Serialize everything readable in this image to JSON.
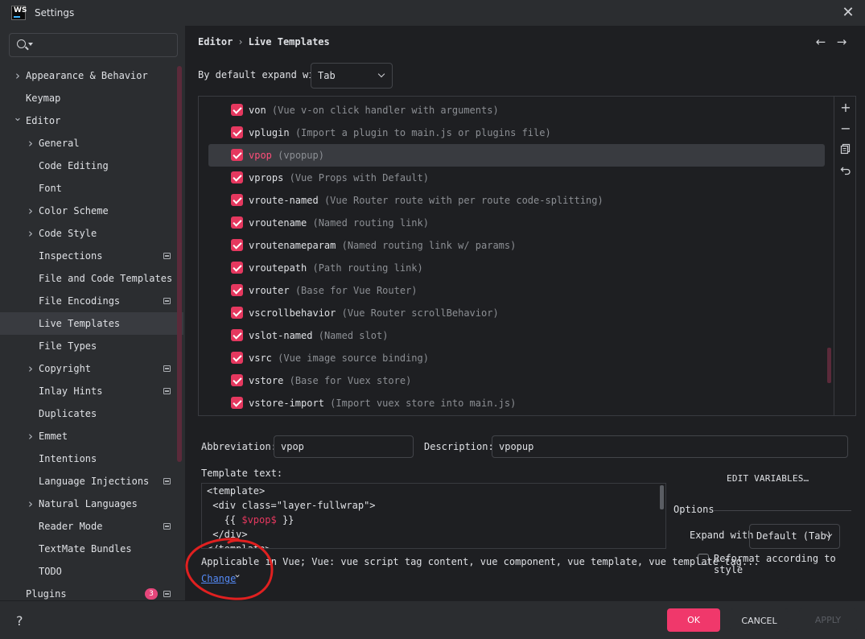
{
  "window": {
    "logo_text": "WS",
    "title": "Settings",
    "close_icon": "close-icon"
  },
  "sidebar": {
    "search": {
      "value": "",
      "placeholder": ""
    },
    "items": [
      {
        "label": "Appearance & Behavior",
        "level": 0,
        "expandable": true,
        "expanded": false
      },
      {
        "label": "Keymap",
        "level": 0,
        "expandable": false
      },
      {
        "label": "Editor",
        "level": 0,
        "expandable": true,
        "expanded": true
      },
      {
        "label": "General",
        "level": 1,
        "expandable": true,
        "expanded": false
      },
      {
        "label": "Code Editing",
        "level": 1,
        "expandable": false
      },
      {
        "label": "Font",
        "level": 1,
        "expandable": false
      },
      {
        "label": "Color Scheme",
        "level": 1,
        "expandable": true,
        "expanded": false
      },
      {
        "label": "Code Style",
        "level": 1,
        "expandable": true,
        "expanded": false
      },
      {
        "label": "Inspections",
        "level": 1,
        "expandable": false,
        "project_icon": true
      },
      {
        "label": "File and Code Templates",
        "level": 1,
        "expandable": false
      },
      {
        "label": "File Encodings",
        "level": 1,
        "expandable": false,
        "project_icon": true
      },
      {
        "label": "Live Templates",
        "level": 1,
        "expandable": false,
        "selected": true
      },
      {
        "label": "File Types",
        "level": 1,
        "expandable": false
      },
      {
        "label": "Copyright",
        "level": 1,
        "expandable": true,
        "expanded": false,
        "project_icon": true
      },
      {
        "label": "Inlay Hints",
        "level": 1,
        "expandable": false,
        "project_icon": true
      },
      {
        "label": "Duplicates",
        "level": 1,
        "expandable": false
      },
      {
        "label": "Emmet",
        "level": 1,
        "expandable": true,
        "expanded": false
      },
      {
        "label": "Intentions",
        "level": 1,
        "expandable": false
      },
      {
        "label": "Language Injections",
        "level": 1,
        "expandable": false,
        "project_icon": true
      },
      {
        "label": "Natural Languages",
        "level": 1,
        "expandable": true,
        "expanded": false
      },
      {
        "label": "Reader Mode",
        "level": 1,
        "expandable": false,
        "project_icon": true
      },
      {
        "label": "TextMate Bundles",
        "level": 1,
        "expandable": false
      },
      {
        "label": "TODO",
        "level": 1,
        "expandable": false
      },
      {
        "label": "Plugins",
        "level": 0,
        "expandable": false,
        "badge": "3",
        "project_icon": true
      }
    ]
  },
  "main": {
    "breadcrumb": {
      "parent": "Editor",
      "separator": "›",
      "current": "Live Templates"
    },
    "expand": {
      "label": "By default expand with",
      "value": "Tab"
    },
    "templates": [
      {
        "abbr": "von",
        "desc": "(Vue v-on click handler with arguments)",
        "checked": true
      },
      {
        "abbr": "vplugin",
        "desc": "(Import a plugin to main.js or plugins file)",
        "checked": true
      },
      {
        "abbr": "vpop",
        "desc": "(vpopup)",
        "checked": true,
        "selected": true
      },
      {
        "abbr": "vprops",
        "desc": "(Vue Props with Default)",
        "checked": true
      },
      {
        "abbr": "vroute-named",
        "desc": "(Vue Router route with per route code-splitting)",
        "checked": true
      },
      {
        "abbr": "vroutename",
        "desc": "(Named routing link)",
        "checked": true
      },
      {
        "abbr": "vroutenameparam",
        "desc": "(Named routing link w/ params)",
        "checked": true
      },
      {
        "abbr": "vroutepath",
        "desc": "(Path routing link)",
        "checked": true
      },
      {
        "abbr": "vrouter",
        "desc": "(Base for Vue Router)",
        "checked": true
      },
      {
        "abbr": "vscrollbehavior",
        "desc": "(Vue Router scrollBehavior)",
        "checked": true
      },
      {
        "abbr": "vslot-named",
        "desc": "(Named slot)",
        "checked": true
      },
      {
        "abbr": "vsrc",
        "desc": "(Vue image source binding)",
        "checked": true
      },
      {
        "abbr": "vstore",
        "desc": "(Base for Vuex store)",
        "checked": true
      },
      {
        "abbr": "vstore-import",
        "desc": "(Import vuex store into main.js)",
        "checked": true
      }
    ],
    "abbreviation": {
      "label": "Abbreviation:",
      "value": "vpop"
    },
    "description": {
      "label": "Description:",
      "value": "vpopup"
    },
    "template_text": {
      "label": "Template text:",
      "lines": [
        {
          "text": "<template>"
        },
        {
          "text": " <div class=\"layer-fullwrap\">"
        },
        {
          "pre": "   {{ ",
          "var": "$vpop$",
          "post": " }}"
        },
        {
          "text": " </div>"
        },
        {
          "text": "</template>"
        }
      ]
    },
    "edit_variables": "EDIT VARIABLES…",
    "options": {
      "title": "Options",
      "expand_with_label": "Expand with",
      "expand_with_value": "Default (Tab)",
      "reformat_label": "Reformat according to style",
      "reformat_checked": false
    },
    "applicable": "Applicable in Vue; Vue: vue script tag content, vue component, vue template, vue template tag...",
    "change_link": "Change"
  },
  "footer": {
    "help": "?",
    "ok": "OK",
    "cancel": "CANCEL",
    "apply": "APPLY"
  },
  "colors": {
    "accent": "#f0386b",
    "checkbox": "#e5385f",
    "link": "#548af7",
    "annotation": "#e02020"
  }
}
